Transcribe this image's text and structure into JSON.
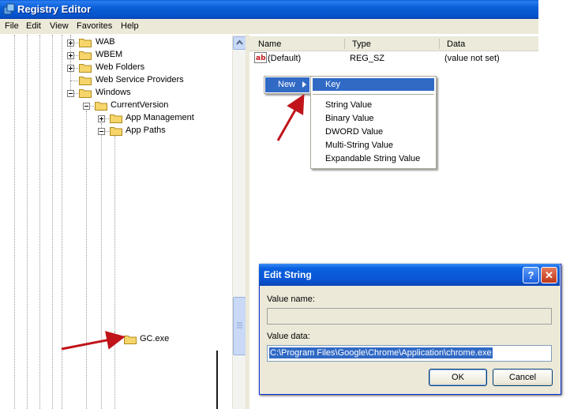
{
  "window": {
    "title": "Registry Editor"
  },
  "menu": [
    "File",
    "Edit",
    "View",
    "Favorites",
    "Help"
  ],
  "tree": {
    "items": [
      {
        "label": "WAB",
        "expander": "plus"
      },
      {
        "label": "WBEM",
        "expander": "plus"
      },
      {
        "label": "Web Folders",
        "expander": "plus"
      },
      {
        "label": "Web Service Providers",
        "expander": "none"
      },
      {
        "label": "Windows",
        "expander": "minus"
      },
      {
        "label": "CurrentVersion",
        "expander": "minus"
      },
      {
        "label": "App Management",
        "expander": "plus"
      },
      {
        "label": "App Paths",
        "expander": "minus"
      }
    ],
    "new_key": "GC.exe"
  },
  "list": {
    "columns": [
      "Name",
      "Type",
      "Data"
    ],
    "rows": [
      {
        "name": "(Default)",
        "type": "REG_SZ",
        "data": "(value not set)"
      }
    ]
  },
  "context_menu": {
    "new_label": "New",
    "submenu": [
      "Key",
      "String Value",
      "Binary Value",
      "DWORD Value",
      "Multi-String Value",
      "Expandable String Value"
    ],
    "highlighted": "Key"
  },
  "dialog": {
    "title": "Edit String",
    "value_name_label": "Value name:",
    "value_name": "",
    "value_data_label": "Value data:",
    "value_data": "C:\\Program Files\\Google\\Chrome\\Application\\chrome.exe",
    "ok_label": "OK",
    "cancel_label": "Cancel",
    "help_glyph": "?",
    "close_glyph": "✕"
  },
  "colors": {
    "title_bar": "#0a5fd8",
    "selection": "#316ac5",
    "annotation_arrow": "#c0141a",
    "folder": "#f6d66a"
  }
}
